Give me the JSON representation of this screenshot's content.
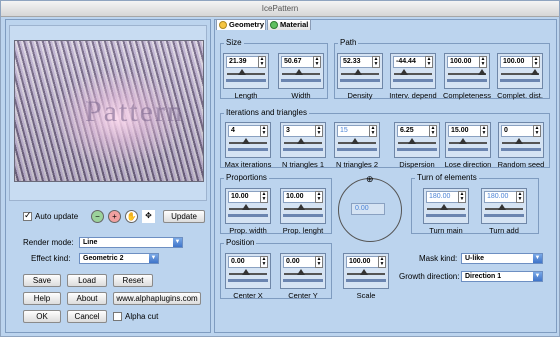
{
  "window": {
    "title": "IcePattern"
  },
  "left": {
    "auto_update_label": "Auto update",
    "auto_update_checked": true,
    "update_button": "Update",
    "render_mode_label": "Render mode:",
    "render_mode_value": "Line",
    "effect_kind_label": "Effect kind:",
    "effect_kind_value": "Geometric 2",
    "buttons": {
      "save": "Save",
      "load": "Load",
      "reset": "Reset",
      "help": "Help",
      "about": "About",
      "website": "www.alphaplugins.com",
      "ok": "OK",
      "cancel": "Cancel"
    },
    "alpha_cut_label": "Alpha cut",
    "alpha_cut_checked": false,
    "tools": [
      "zoom-out-icon",
      "zoom-in-icon",
      "hand-icon",
      "move-icon"
    ]
  },
  "tabs": {
    "geometry": "Geometry",
    "material": "Material"
  },
  "size": {
    "title": "Size",
    "length": {
      "value": "21.39",
      "label": "Length",
      "fraction": 0.45
    },
    "width": {
      "value": "50.67",
      "label": "Width",
      "fraction": 0.5
    }
  },
  "path": {
    "title": "Path",
    "density": {
      "value": "52.33",
      "label": "Density",
      "fraction": 0.5
    },
    "interv": {
      "value": "-44.44",
      "label": "Interv. depend",
      "fraction": 0.3
    },
    "completeness": {
      "value": "100.00",
      "label": "Completeness",
      "fraction": 1.0
    },
    "complet_dist": {
      "value": "100.00",
      "label": "Complet. dist.",
      "fraction": 1.0
    }
  },
  "iterations": {
    "title": "Iterations and triangles",
    "max": {
      "value": "4",
      "label": "Max iterations",
      "fraction": 0.5
    },
    "n1": {
      "value": "3",
      "label": "N triangles 1",
      "fraction": 0.5
    },
    "n2": {
      "value": "15",
      "label": "N triangles 2",
      "fraction": 0.5
    },
    "dispersion": {
      "value": "6.25",
      "label": "Dispersion",
      "fraction": 0.4
    },
    "lose_direction": {
      "value": "15.00",
      "label": "Lose direction",
      "fraction": 0.4
    },
    "random_seed": {
      "value": "0",
      "label": "Random seed",
      "fraction": 0.5
    }
  },
  "proportions": {
    "title": "Proportions",
    "prop_width": {
      "value": "10.00",
      "label": "Prop. width",
      "fraction": 0.5
    },
    "prop_length": {
      "value": "10.00",
      "label": "Prop. lenght",
      "fraction": 0.5
    }
  },
  "dial": {
    "value": "0.00"
  },
  "turn": {
    "title": "Turn of elements",
    "main": {
      "value": "180.00",
      "label": "Turn main",
      "fraction": 0.5
    },
    "add": {
      "value": "180.00",
      "label": "Turn add",
      "fraction": 0.5
    }
  },
  "position": {
    "title": "Position",
    "x": {
      "value": "0.00",
      "label": "Center X",
      "fraction": 0.5
    },
    "y": {
      "value": "0.00",
      "label": "Center Y",
      "fraction": 0.5
    }
  },
  "scale": {
    "value": "100.00",
    "label": "Scale",
    "fraction": 0.5
  },
  "mask_kind": {
    "label": "Mask kind:",
    "value": "U-like"
  },
  "growth_direction": {
    "label": "Growth direction:",
    "value": "Direction 1"
  },
  "preview_watermark": "Pattern"
}
